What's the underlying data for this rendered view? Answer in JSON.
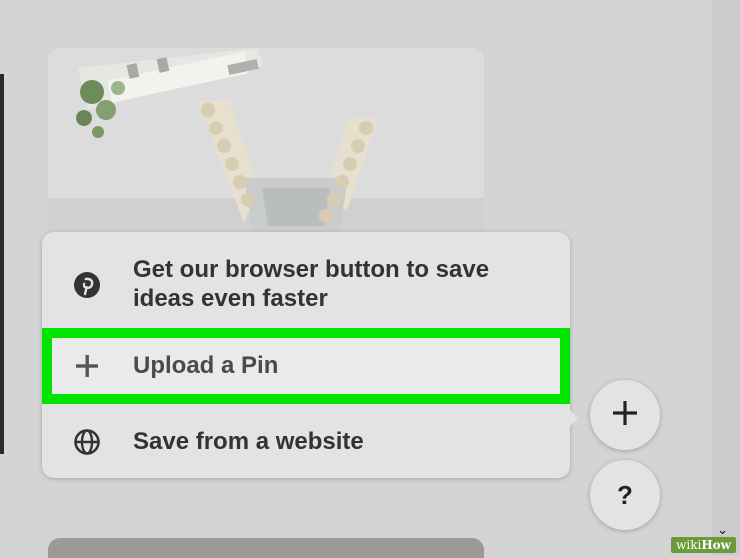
{
  "menu": {
    "items": [
      {
        "label": "Get our browser button to save ideas even faster",
        "icon": "pinterest-icon"
      },
      {
        "label": "Upload a Pin",
        "icon": "plus-icon",
        "highlight": "#00e400"
      },
      {
        "label": "Save from a website",
        "icon": "globe-icon"
      }
    ]
  },
  "fab": {
    "create_icon": "plus-icon",
    "help_label": "?"
  },
  "watermark": {
    "wiki": "wiki",
    "how": "How"
  },
  "colors": {
    "page_bg": "#d4d4d4",
    "menu_bg": "#e3e3e3",
    "highlight": "#00e400",
    "text": "#333333"
  }
}
